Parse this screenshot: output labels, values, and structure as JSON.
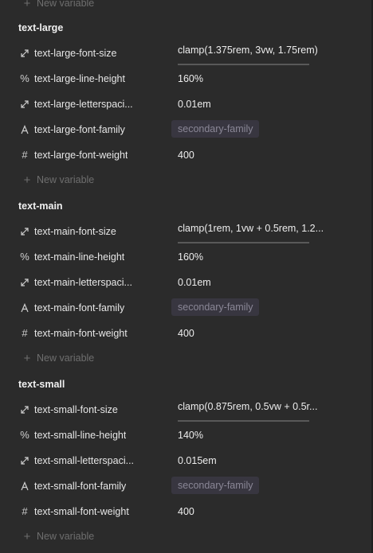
{
  "top_new_variable": "New variable",
  "groups": [
    {
      "title": "text-large",
      "rows": [
        {
          "icon": "resize-icon",
          "name": "text-large-font-size",
          "value": "clamp(1.375rem, 3vw, 1.75rem)",
          "kind": "input"
        },
        {
          "icon": "percent-icon",
          "name": "text-large-line-height",
          "value": "160%",
          "kind": "text"
        },
        {
          "icon": "resize-icon",
          "name": "text-large-letterspaci...",
          "value": "0.01em",
          "kind": "text"
        },
        {
          "icon": "font-icon",
          "name": "text-large-font-family",
          "value": "secondary-family",
          "kind": "chip"
        },
        {
          "icon": "hash-icon",
          "name": "text-large-font-weight",
          "value": "400",
          "kind": "text"
        }
      ],
      "new_variable": "New variable"
    },
    {
      "title": "text-main",
      "rows": [
        {
          "icon": "resize-icon",
          "name": "text-main-font-size",
          "value": "clamp(1rem, 1vw + 0.5rem, 1.2...",
          "kind": "input"
        },
        {
          "icon": "percent-icon",
          "name": "text-main-line-height",
          "value": "160%",
          "kind": "text"
        },
        {
          "icon": "resize-icon",
          "name": "text-main-letterspaci...",
          "value": "0.01em",
          "kind": "text"
        },
        {
          "icon": "font-icon",
          "name": "text-main-font-family",
          "value": "secondary-family",
          "kind": "chip"
        },
        {
          "icon": "hash-icon",
          "name": "text-main-font-weight",
          "value": "400",
          "kind": "text"
        }
      ],
      "new_variable": "New variable"
    },
    {
      "title": "text-small",
      "rows": [
        {
          "icon": "resize-icon",
          "name": "text-small-font-size",
          "value": "clamp(0.875rem, 0.5vw + 0.5r...",
          "kind": "input"
        },
        {
          "icon": "percent-icon",
          "name": "text-small-line-height",
          "value": "140%",
          "kind": "text"
        },
        {
          "icon": "resize-icon",
          "name": "text-small-letterspaci...",
          "value": "0.015em",
          "kind": "text"
        },
        {
          "icon": "font-icon",
          "name": "text-small-font-family",
          "value": "secondary-family",
          "kind": "chip"
        },
        {
          "icon": "hash-icon",
          "name": "text-small-font-weight",
          "value": "400",
          "kind": "text"
        }
      ],
      "new_variable": "New variable"
    }
  ]
}
